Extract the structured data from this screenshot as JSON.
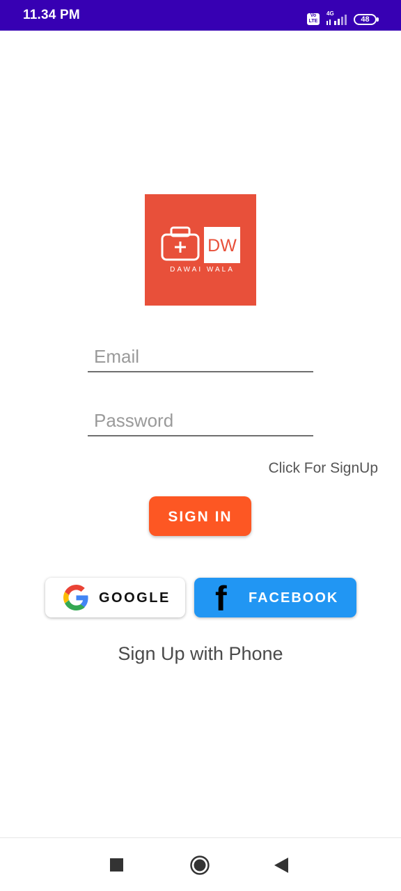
{
  "status_bar": {
    "time": "11.34 PM",
    "volte": "Vo LTE",
    "network": "4G",
    "battery": "48"
  },
  "logo": {
    "initials": "DW",
    "name": "DAWAI WALA",
    "icon": "medical-kit-icon"
  },
  "form": {
    "email_placeholder": "Email",
    "password_placeholder": "Password",
    "signup_link": "Click For SignUp",
    "signin_label": "SIGN IN"
  },
  "social": {
    "google_label": "GOOGLE",
    "facebook_label": "FACEBOOK",
    "facebook_glyph": "f"
  },
  "phone_signup": "Sign Up with Phone",
  "nav": {
    "recents_icon": "square-icon",
    "home_icon": "circle-icon",
    "back_icon": "triangle-back-icon"
  },
  "colors": {
    "status_bar": "#3700b3",
    "logo_bg": "#e8503a",
    "signin_button": "#fd5723",
    "facebook_button": "#2196f3"
  }
}
